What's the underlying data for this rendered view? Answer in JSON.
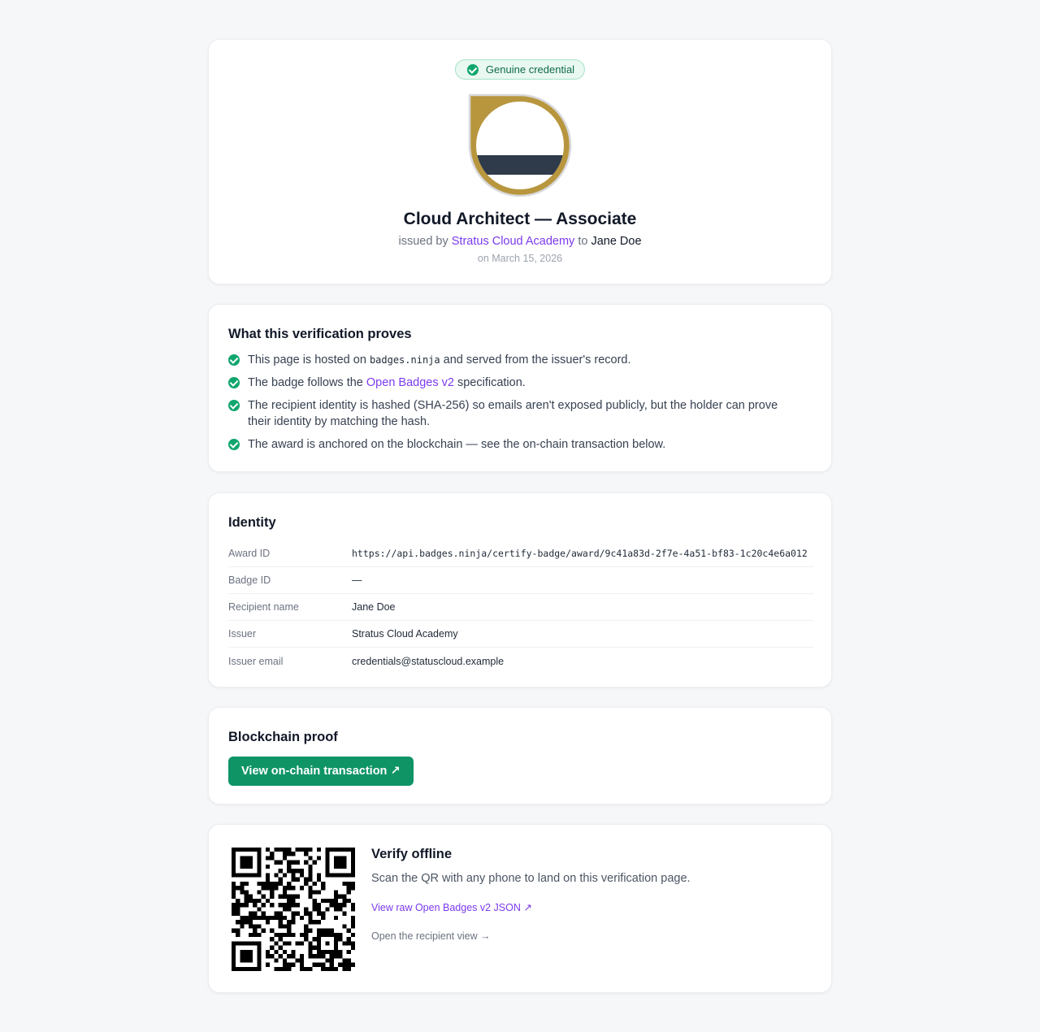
{
  "header": {
    "status_badge": "Genuine credential",
    "badge_title": "Cloud Architect — Associate",
    "issued_by_prefix": "issued by",
    "issuer_name": "Stratus Cloud Academy",
    "to_word": "to",
    "recipient_name": "Jane Doe",
    "date_text": "on March 15, 2026",
    "badge_image": {
      "icon": "badge-image-icon",
      "ring_color": "#b8963e",
      "band_color": "#2f3b4a"
    }
  },
  "proves": {
    "title": "What this verification proves",
    "items": [
      {
        "pre": "This page is hosted on",
        "code": "badges.ninja",
        "post": "and served from the issuer's record."
      },
      {
        "pre": "The badge follows the",
        "link": "Open Badges v2",
        "post": "specification."
      },
      {
        "text": "The recipient identity is hashed (SHA-256) so emails aren't exposed publicly, but the holder can prove their identity by matching the hash."
      },
      {
        "text": "The award is anchored on the blockchain — see the on-chain transaction below."
      }
    ]
  },
  "identity": {
    "title": "Identity",
    "rows": [
      {
        "label": "Award ID",
        "value": "https://api.badges.ninja/certify-badge/award/9c41a83d-2f7e-4a51-bf83-1c20c4e6a012"
      },
      {
        "label": "Badge ID",
        "value": "—"
      },
      {
        "label": "Recipient name",
        "value": "Jane Doe"
      },
      {
        "label": "Issuer",
        "value": "Stratus Cloud Academy"
      },
      {
        "label": "Issuer email",
        "value": "credentials@statuscloud.example"
      }
    ]
  },
  "blockchain": {
    "title": "Blockchain proof",
    "button_label": "View on-chain transaction ↗"
  },
  "offline": {
    "title": "Verify offline",
    "description": "Scan the QR with any phone to land on this verification page.",
    "json_link": "View raw Open Badges v2 JSON ↗",
    "recipient_link": "Open the recipient view →",
    "qr_icon": "qr-code-icon"
  },
  "colors": {
    "accent_purple": "#7c3aed",
    "success_green": "#10a66e",
    "button_green": "#0f9466",
    "background": "#f6f7f9"
  }
}
